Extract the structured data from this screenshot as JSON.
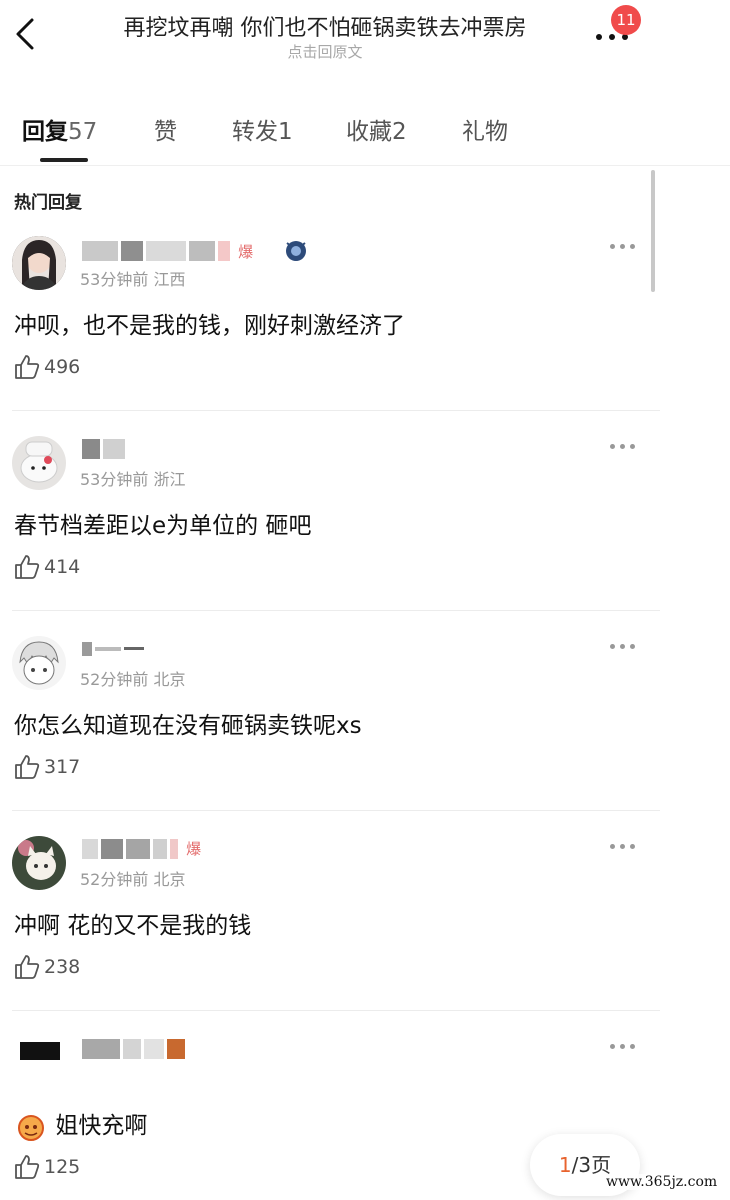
{
  "header": {
    "title": "再挖坟再嘲 你们也不怕砸锅卖铁去冲票房",
    "subtitle": "点击回原文",
    "badge": "11"
  },
  "tabs": [
    {
      "label": "回复",
      "count": "57"
    },
    {
      "label": "赞",
      "count": ""
    },
    {
      "label": "转发",
      "count": "1"
    },
    {
      "label": "收藏",
      "count": "2"
    },
    {
      "label": "礼物",
      "count": ""
    }
  ],
  "section_title": "热门回复",
  "comments": [
    {
      "meta": "53分钟前 江西",
      "text": "冲呗，也不是我的钱，刚好刺激经济了",
      "likes": "496",
      "tag": "爆"
    },
    {
      "meta": "53分钟前 浙江",
      "text": "春节档差距以e为单位的 砸吧",
      "likes": "414"
    },
    {
      "meta": "52分钟前 北京",
      "text": "你怎么知道现在没有砸锅卖铁呢xs",
      "likes": "317"
    },
    {
      "meta": "52分钟前 北京",
      "text": "冲啊  花的又不是我的钱",
      "likes": "238",
      "tag": "爆"
    },
    {
      "meta": "",
      "text": "姐快充啊",
      "likes": "125"
    }
  ],
  "pager": {
    "current": "1",
    "total": "/3页"
  },
  "watermark": "www.365jz.com"
}
